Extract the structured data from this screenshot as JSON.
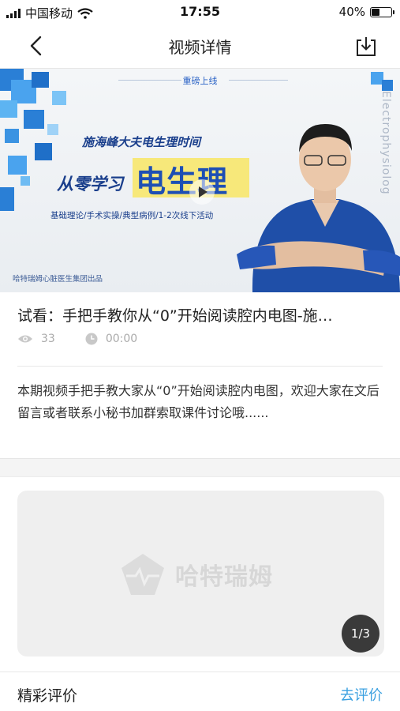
{
  "status_bar": {
    "carrier": "中国移动",
    "time": "17:55",
    "battery": "40%",
    "battery_level": 0.4
  },
  "nav": {
    "title": "视频详情"
  },
  "banner": {
    "tag": "重磅上线",
    "subtitle": "施海峰大夫电生理时间",
    "main_left": "从零学习",
    "main_right": "电生理",
    "topics": "基础理论/手术实操/典型病例/1-2次线下活动",
    "credit": "哈特瑞姆心脏医生集团出品",
    "side_text": "Electrophysiolog",
    "accent_color": "#1e4fb4"
  },
  "video": {
    "title": "试看：手把手教你从“0”开始阅读腔内电图-施…",
    "views": "33",
    "duration": "00:00",
    "description": "本期视频手把手教大家从“0”开始阅读腔内电图，欢迎大家在文后留言或者联系小秘书加群索取课件讨论哦......"
  },
  "carousel": {
    "logo_text": "哈特瑞姆",
    "page_indicator": "1/3"
  },
  "reviews": {
    "title": "精彩评价",
    "action": "去评价"
  }
}
